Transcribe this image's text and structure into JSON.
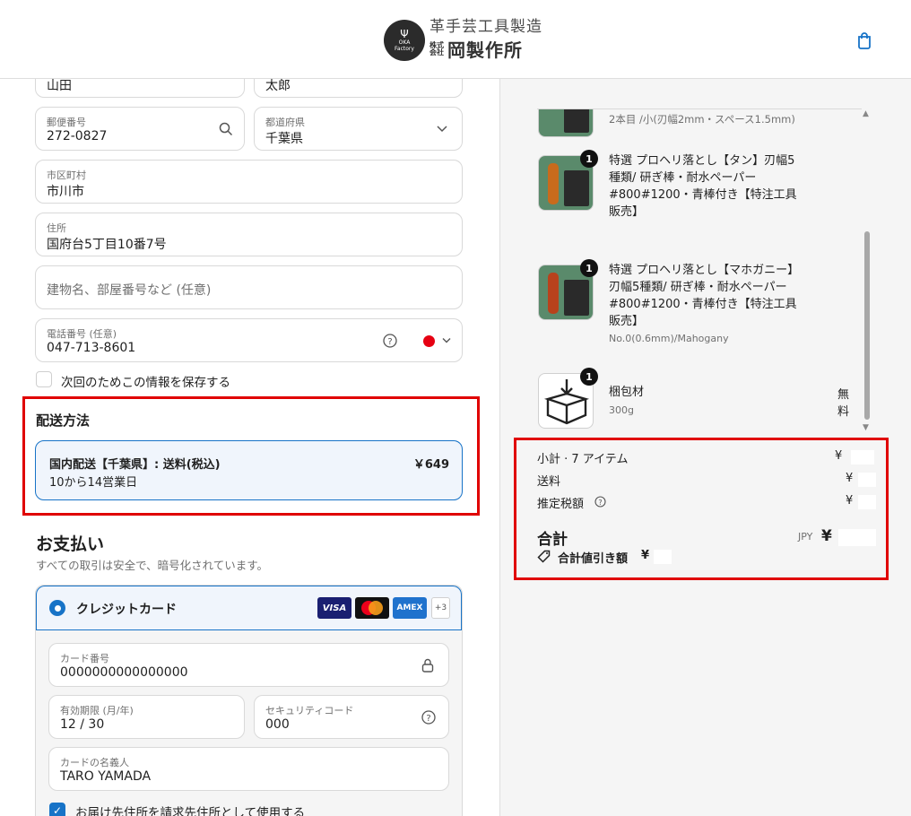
{
  "header": {
    "logo_title": "革手芸工具製造",
    "logo_kabushiki": "株式会社",
    "logo_name": "岡製作所",
    "logo_circle_text": "OKA Factory"
  },
  "address": {
    "last_name": "山田",
    "first_name": "太郎",
    "postal_label": "郵便番号",
    "postal_value": "272-0827",
    "prefecture_label": "都道府県",
    "prefecture_value": "千葉県",
    "city_label": "市区町村",
    "city_value": "市川市",
    "address_label": "住所",
    "address_value": "国府台5丁目10番7号",
    "building_placeholder": "建物名、部屋番号など (任意)",
    "phone_label": "電話番号 (任意)",
    "phone_value": "047-713-8601",
    "save_info_label": "次回のためこの情報を保存する"
  },
  "shipping": {
    "title": "配送方法",
    "option_name": "国内配送【千葉県】: 送料(税込)",
    "option_eta": "10から14営業日",
    "option_price": "￥649"
  },
  "payment": {
    "title": "お支払い",
    "subtitle": "すべての取引は安全で、暗号化されています。",
    "method_label": "クレジットカード",
    "card_brands": [
      "VISA",
      "AMEX"
    ],
    "more_brands": "+3",
    "card_number_label": "カード番号",
    "card_number_value": "0000000000000000",
    "expiry_label": "有効期限 (月/年)",
    "expiry_value": "12 / 30",
    "cvc_label": "セキュリティコード",
    "cvc_value": "000",
    "cardholder_label": "カードの名義人",
    "cardholder_value": "TARO YAMADA",
    "billing_same_label": "お届け先住所を請求先住所として使用する"
  },
  "cart": {
    "items": [
      {
        "name": "",
        "variant": "2本目 /小(刃幅2mm・スペース1.5mm)",
        "qty": ""
      },
      {
        "name": "特選 プロヘリ落とし【タン】刃幅5種類/ 研ぎ棒・耐水ペーパー#800#1200・青棒付き【特注工具販売】",
        "name_lines": [
          "特選 プロヘリ落とし【タン】刃幅5",
          "種類/ 研ぎ棒・耐水ペーパー",
          "#800#1200・青棒付き【特注工具",
          "販売】"
        ],
        "variant": "",
        "qty": "1"
      },
      {
        "name": "特選 プロヘリ落とし【マホガニー】刃幅5種類/ 研ぎ棒・耐水ペーパー#800#1200・青棒付き【特注工具販売】",
        "name_lines": [
          "特選 プロヘリ落とし【マホガニー】",
          "刃幅5種類/ 研ぎ棒・耐水ペーパー",
          "#800#1200・青棒付き【特注工具",
          "販売】"
        ],
        "variant": "No.0(0.6mm)/Mahogany",
        "qty": "1"
      },
      {
        "name": "梱包材",
        "variant": "300g",
        "qty": "1",
        "price": "無料"
      }
    ]
  },
  "summary": {
    "subtotal_label": "小計 · 7 アイテム",
    "subtotal_value": "¥",
    "shipping_label": "送料",
    "shipping_value": "¥",
    "tax_label": "推定税額",
    "tax_value": "¥",
    "total_label": "合計",
    "currency": "JPY",
    "total_value": "¥",
    "discount_label": "合計値引き額",
    "discount_value": "¥"
  },
  "colors": {
    "accent": "#1773c7",
    "highlight_border": "#e00000",
    "flag_red": "#e60012"
  }
}
